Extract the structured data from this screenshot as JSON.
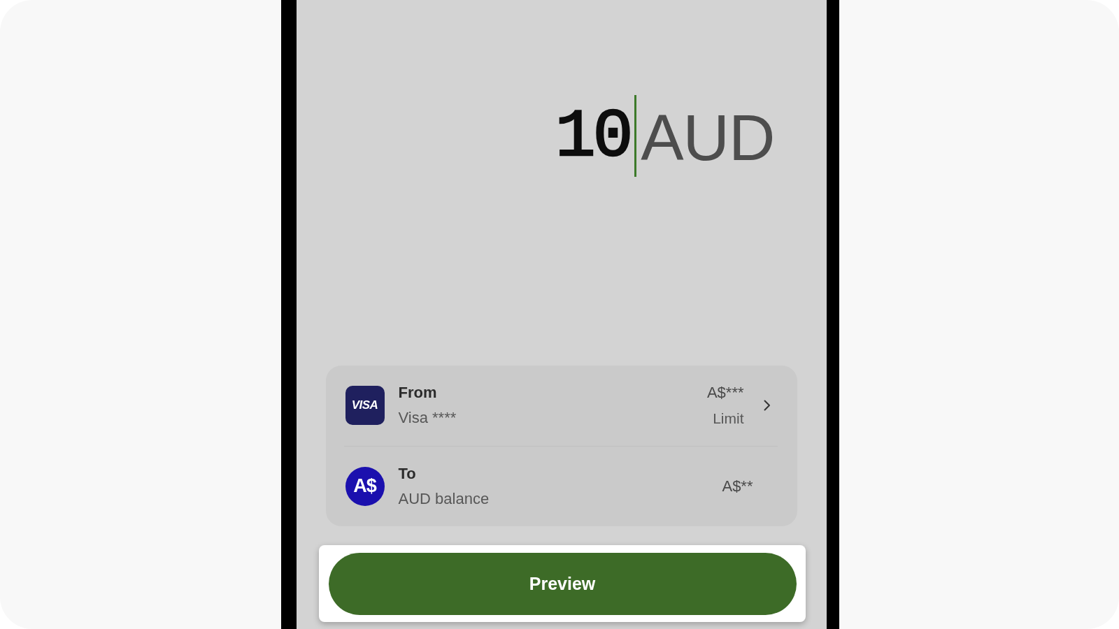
{
  "amount": {
    "value": "10",
    "currency": "AUD",
    "focused": true
  },
  "transfer": [
    {
      "kind": "card",
      "logo": "VISA",
      "label": "From",
      "detail": "Visa ****",
      "amount": "A$***",
      "note": "Limit",
      "chevron": true
    },
    {
      "kind": "balance",
      "logo": "A$",
      "label": "To",
      "detail": "AUD balance",
      "amount": "A$**",
      "chevron": false
    }
  ],
  "button": {
    "label": "Preview"
  }
}
